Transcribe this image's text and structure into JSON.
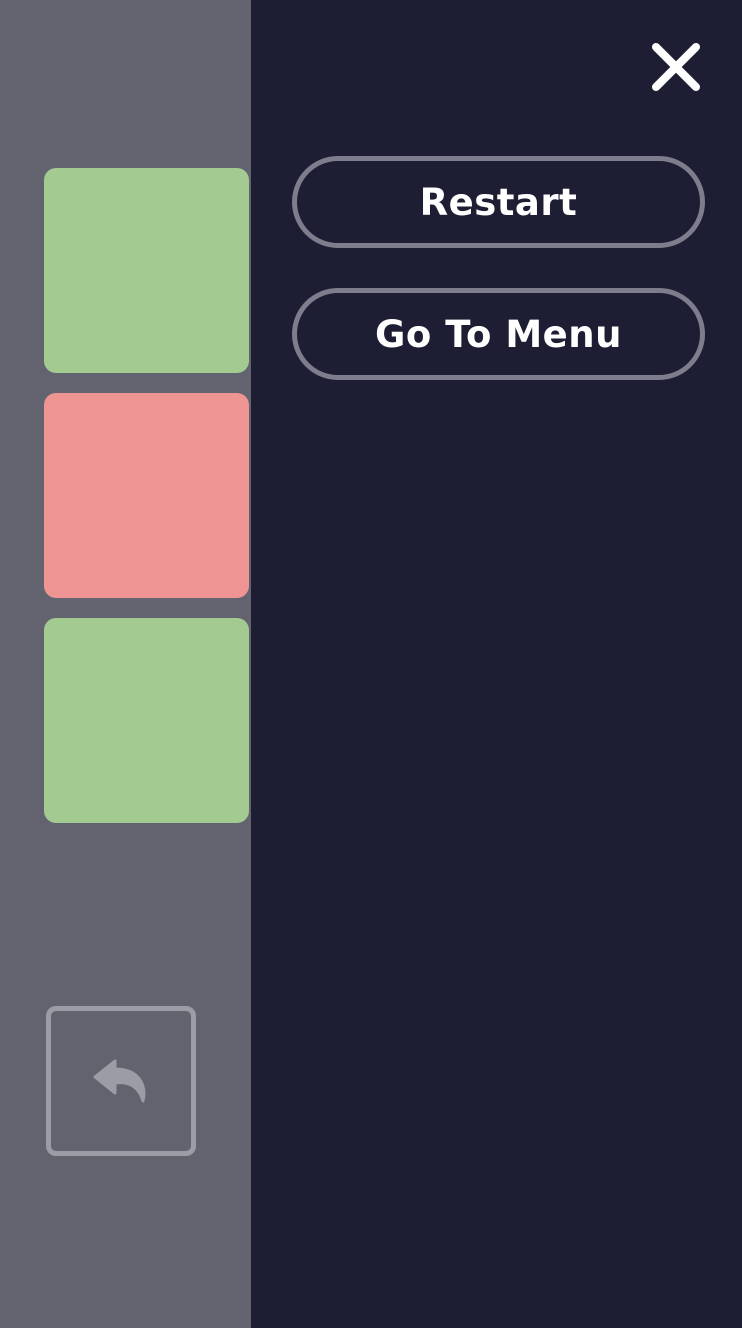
{
  "colors": {
    "board_background": "#62636f",
    "panel_background": "#1d1d33",
    "tile_green": "#a3ca91",
    "tile_red": "#ee9594",
    "outline": "#7d7d8d",
    "undo_outline": "#9c9ca6",
    "text": "#ffffff"
  },
  "board": {
    "tiles": [
      {
        "state": "green",
        "color": "#a3ca91"
      },
      {
        "state": "red",
        "color": "#ee9594"
      },
      {
        "state": "green",
        "color": "#a3ca91"
      }
    ],
    "undo_icon": "undo-arrow-icon"
  },
  "menu": {
    "close_icon": "close-icon",
    "restart_label": "Restart",
    "go_to_menu_label": "Go To Menu"
  }
}
